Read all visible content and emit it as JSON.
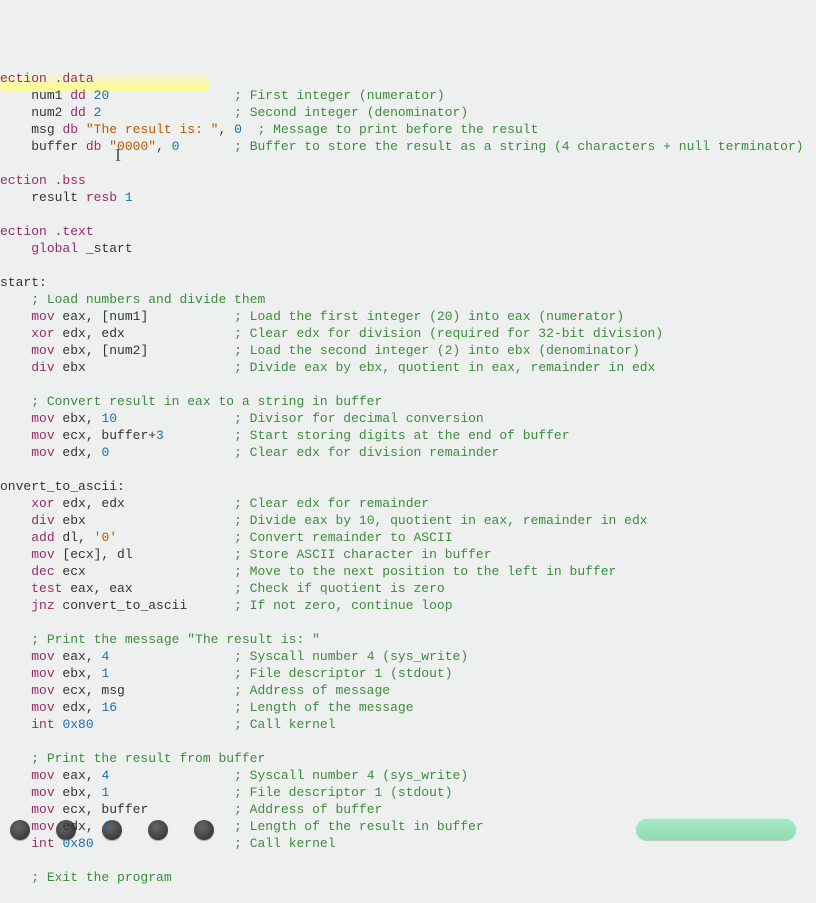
{
  "cursor_glyph": "I",
  "lines": [
    {
      "indent": 0,
      "segs": [
        {
          "c": "kw",
          "t": "ection"
        },
        {
          "c": "",
          "t": " "
        },
        {
          "c": "sect",
          "t": ".data"
        }
      ]
    },
    {
      "indent": 4,
      "segs": [
        {
          "c": "",
          "t": "num1 "
        },
        {
          "c": "kw",
          "t": "dd"
        },
        {
          "c": "",
          "t": " "
        },
        {
          "c": "num",
          "t": "20"
        }
      ],
      "comment_col": 30,
      "comment": "; First integer (numerator)"
    },
    {
      "indent": 4,
      "segs": [
        {
          "c": "",
          "t": "num2 "
        },
        {
          "c": "kw",
          "t": "dd"
        },
        {
          "c": "",
          "t": " "
        },
        {
          "c": "num",
          "t": "2"
        }
      ],
      "comment_col": 30,
      "comment": "; Second integer (denominator)"
    },
    {
      "indent": 4,
      "segs": [
        {
          "c": "",
          "t": "msg "
        },
        {
          "c": "kw",
          "t": "db"
        },
        {
          "c": "",
          "t": " "
        },
        {
          "c": "str",
          "t": "\"The result is: \""
        },
        {
          "c": "",
          "t": ", "
        },
        {
          "c": "num",
          "t": "0"
        },
        {
          "c": "",
          "t": " "
        }
      ],
      "comment_col": 31,
      "comment": "; Message to print before the result"
    },
    {
      "indent": 4,
      "segs": [
        {
          "c": "",
          "t": "buffer "
        },
        {
          "c": "kw",
          "t": "db"
        },
        {
          "c": "",
          "t": " "
        },
        {
          "c": "str",
          "t": "\"0000\""
        },
        {
          "c": "",
          "t": ", "
        },
        {
          "c": "num",
          "t": "0"
        }
      ],
      "comment_col": 30,
      "comment": "; Buffer to store the result as a string (4 characters + null terminator)"
    },
    {
      "blank": true
    },
    {
      "indent": 0,
      "segs": [
        {
          "c": "kw",
          "t": "ection"
        },
        {
          "c": "",
          "t": " "
        },
        {
          "c": "sect",
          "t": ".bss"
        }
      ]
    },
    {
      "indent": 4,
      "segs": [
        {
          "c": "",
          "t": "result "
        },
        {
          "c": "kw",
          "t": "resb"
        },
        {
          "c": "",
          "t": " "
        },
        {
          "c": "num",
          "t": "1"
        }
      ]
    },
    {
      "blank": true
    },
    {
      "indent": 0,
      "segs": [
        {
          "c": "kw",
          "t": "ection"
        },
        {
          "c": "",
          "t": " "
        },
        {
          "c": "sect",
          "t": ".text"
        }
      ]
    },
    {
      "indent": 4,
      "segs": [
        {
          "c": "kw",
          "t": "global"
        },
        {
          "c": "",
          "t": " _start"
        }
      ]
    },
    {
      "blank": true
    },
    {
      "indent": 0,
      "segs": [
        {
          "c": "lbl",
          "t": "start:"
        }
      ]
    },
    {
      "indent": 4,
      "segs": [
        {
          "c": "cmt",
          "t": "; Load numbers and divide them"
        }
      ]
    },
    {
      "indent": 4,
      "segs": [
        {
          "c": "kw",
          "t": "mov"
        },
        {
          "c": "",
          "t": " eax, [num1]"
        }
      ],
      "comment_col": 30,
      "comment": "; Load the first integer (20) into eax (numerator)"
    },
    {
      "indent": 4,
      "segs": [
        {
          "c": "kw",
          "t": "xor"
        },
        {
          "c": "",
          "t": " edx, edx"
        }
      ],
      "comment_col": 30,
      "comment": "; Clear edx for division (required for 32-bit division)"
    },
    {
      "indent": 4,
      "segs": [
        {
          "c": "kw",
          "t": "mov"
        },
        {
          "c": "",
          "t": " ebx, [num2]"
        }
      ],
      "comment_col": 30,
      "comment": "; Load the second integer (2) into ebx (denominator)"
    },
    {
      "indent": 4,
      "segs": [
        {
          "c": "kw",
          "t": "div"
        },
        {
          "c": "",
          "t": " ebx"
        }
      ],
      "comment_col": 30,
      "comment": "; Divide eax by ebx, quotient in eax, remainder in edx"
    },
    {
      "blank": true
    },
    {
      "indent": 4,
      "segs": [
        {
          "c": "cmt",
          "t": "; Convert result in eax to a string in buffer"
        }
      ]
    },
    {
      "indent": 4,
      "segs": [
        {
          "c": "kw",
          "t": "mov"
        },
        {
          "c": "",
          "t": " ebx, "
        },
        {
          "c": "num",
          "t": "10"
        }
      ],
      "comment_col": 30,
      "comment": "; Divisor for decimal conversion"
    },
    {
      "indent": 4,
      "segs": [
        {
          "c": "kw",
          "t": "mov"
        },
        {
          "c": "",
          "t": " ecx, buffer+"
        },
        {
          "c": "num",
          "t": "3"
        }
      ],
      "comment_col": 30,
      "comment": "; Start storing digits at the end of buffer"
    },
    {
      "indent": 4,
      "segs": [
        {
          "c": "kw",
          "t": "mov"
        },
        {
          "c": "",
          "t": " edx, "
        },
        {
          "c": "num",
          "t": "0"
        }
      ],
      "comment_col": 30,
      "comment": "; Clear edx for division remainder"
    },
    {
      "blank": true
    },
    {
      "indent": 0,
      "segs": [
        {
          "c": "lbl",
          "t": "onvert_to_ascii:"
        }
      ]
    },
    {
      "indent": 4,
      "segs": [
        {
          "c": "kw",
          "t": "xor"
        },
        {
          "c": "",
          "t": " edx, edx"
        }
      ],
      "comment_col": 30,
      "comment": "; Clear edx for remainder"
    },
    {
      "indent": 4,
      "segs": [
        {
          "c": "kw",
          "t": "div"
        },
        {
          "c": "",
          "t": " ebx"
        }
      ],
      "comment_col": 30,
      "comment": "; Divide eax by 10, quotient in eax, remainder in edx"
    },
    {
      "indent": 4,
      "segs": [
        {
          "c": "kw",
          "t": "add"
        },
        {
          "c": "",
          "t": " dl, "
        },
        {
          "c": "str",
          "t": "'0'"
        }
      ],
      "comment_col": 30,
      "comment": "; Convert remainder to ASCII"
    },
    {
      "indent": 4,
      "segs": [
        {
          "c": "kw",
          "t": "mov"
        },
        {
          "c": "",
          "t": " [ecx], dl"
        }
      ],
      "comment_col": 30,
      "comment": "; Store ASCII character in buffer"
    },
    {
      "indent": 4,
      "segs": [
        {
          "c": "kw",
          "t": "dec"
        },
        {
          "c": "",
          "t": " ecx"
        }
      ],
      "comment_col": 30,
      "comment": "; Move to the next position to the left in buffer"
    },
    {
      "indent": 4,
      "segs": [
        {
          "c": "kw",
          "t": "test"
        },
        {
          "c": "",
          "t": " eax, eax"
        }
      ],
      "comment_col": 30,
      "comment": "; Check if quotient is zero"
    },
    {
      "indent": 4,
      "segs": [
        {
          "c": "kw",
          "t": "jnz"
        },
        {
          "c": "",
          "t": " convert_to_ascii"
        }
      ],
      "comment_col": 30,
      "comment": "; If not zero, continue loop"
    },
    {
      "blank": true
    },
    {
      "indent": 4,
      "segs": [
        {
          "c": "cmt",
          "t": "; Print the message \"The result is: \""
        }
      ]
    },
    {
      "indent": 4,
      "segs": [
        {
          "c": "kw",
          "t": "mov"
        },
        {
          "c": "",
          "t": " eax, "
        },
        {
          "c": "num",
          "t": "4"
        }
      ],
      "comment_col": 30,
      "comment": "; Syscall number 4 (sys_write)"
    },
    {
      "indent": 4,
      "segs": [
        {
          "c": "kw",
          "t": "mov"
        },
        {
          "c": "",
          "t": " ebx, "
        },
        {
          "c": "num",
          "t": "1"
        }
      ],
      "comment_col": 30,
      "comment": "; File descriptor 1 (stdout)"
    },
    {
      "indent": 4,
      "segs": [
        {
          "c": "kw",
          "t": "mov"
        },
        {
          "c": "",
          "t": " ecx, msg"
        }
      ],
      "comment_col": 30,
      "comment": "; Address of message"
    },
    {
      "indent": 4,
      "segs": [
        {
          "c": "kw",
          "t": "mov"
        },
        {
          "c": "",
          "t": " edx, "
        },
        {
          "c": "num",
          "t": "16"
        }
      ],
      "comment_col": 30,
      "comment": "; Length of the message"
    },
    {
      "indent": 4,
      "segs": [
        {
          "c": "kw",
          "t": "int"
        },
        {
          "c": "",
          "t": " "
        },
        {
          "c": "num",
          "t": "0x80"
        }
      ],
      "comment_col": 30,
      "comment": "; Call kernel"
    },
    {
      "blank": true
    },
    {
      "indent": 4,
      "segs": [
        {
          "c": "cmt",
          "t": "; Print the result from buffer"
        }
      ]
    },
    {
      "indent": 4,
      "segs": [
        {
          "c": "kw",
          "t": "mov"
        },
        {
          "c": "",
          "t": " eax, "
        },
        {
          "c": "num",
          "t": "4"
        }
      ],
      "comment_col": 30,
      "comment": "; Syscall number 4 (sys_write)"
    },
    {
      "indent": 4,
      "segs": [
        {
          "c": "kw",
          "t": "mov"
        },
        {
          "c": "",
          "t": " ebx, "
        },
        {
          "c": "num",
          "t": "1"
        }
      ],
      "comment_col": 30,
      "comment": "; File descriptor 1 (stdout)"
    },
    {
      "indent": 4,
      "segs": [
        {
          "c": "kw",
          "t": "mov"
        },
        {
          "c": "",
          "t": " ecx, buffer"
        }
      ],
      "comment_col": 30,
      "comment": "; Address of buffer"
    },
    {
      "indent": 4,
      "segs": [
        {
          "c": "kw",
          "t": "mov"
        },
        {
          "c": "",
          "t": " edx, "
        },
        {
          "c": "num",
          "t": "4"
        }
      ],
      "comment_col": 30,
      "comment": "; Length of the result in buffer"
    },
    {
      "indent": 4,
      "segs": [
        {
          "c": "kw",
          "t": "int"
        },
        {
          "c": "",
          "t": " "
        },
        {
          "c": "num",
          "t": "0x80"
        }
      ],
      "comment_col": 30,
      "comment": "; Call kernel"
    },
    {
      "blank": true
    },
    {
      "indent": 4,
      "segs": [
        {
          "c": "cmt",
          "t": "; Exit the program"
        }
      ]
    }
  ]
}
